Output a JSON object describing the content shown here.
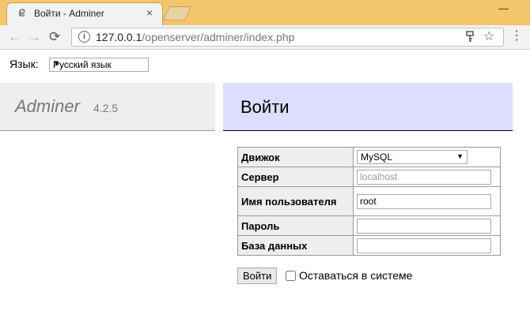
{
  "browser": {
    "tab_title": "Войти - Adminer",
    "tab_close": "×",
    "window_min": "—",
    "url_host": "127.0.0.1",
    "url_path": "/openserver/adminer/index.php"
  },
  "language": {
    "label": "Язык:",
    "selected": "Русский язык"
  },
  "sidebar": {
    "brand": "Adminer",
    "version": "4.2.5"
  },
  "content": {
    "title": "Войти"
  },
  "form": {
    "driver_label": "Движок",
    "driver_value": "MySQL",
    "server_label": "Сервер",
    "server_placeholder": "localhost",
    "username_label": "Имя пользователя",
    "username_value": "root",
    "password_label": "Пароль",
    "password_value": "",
    "database_label": "База данных",
    "database_value": "",
    "submit_label": "Войти",
    "permanent_label": "Оставаться в системе"
  }
}
